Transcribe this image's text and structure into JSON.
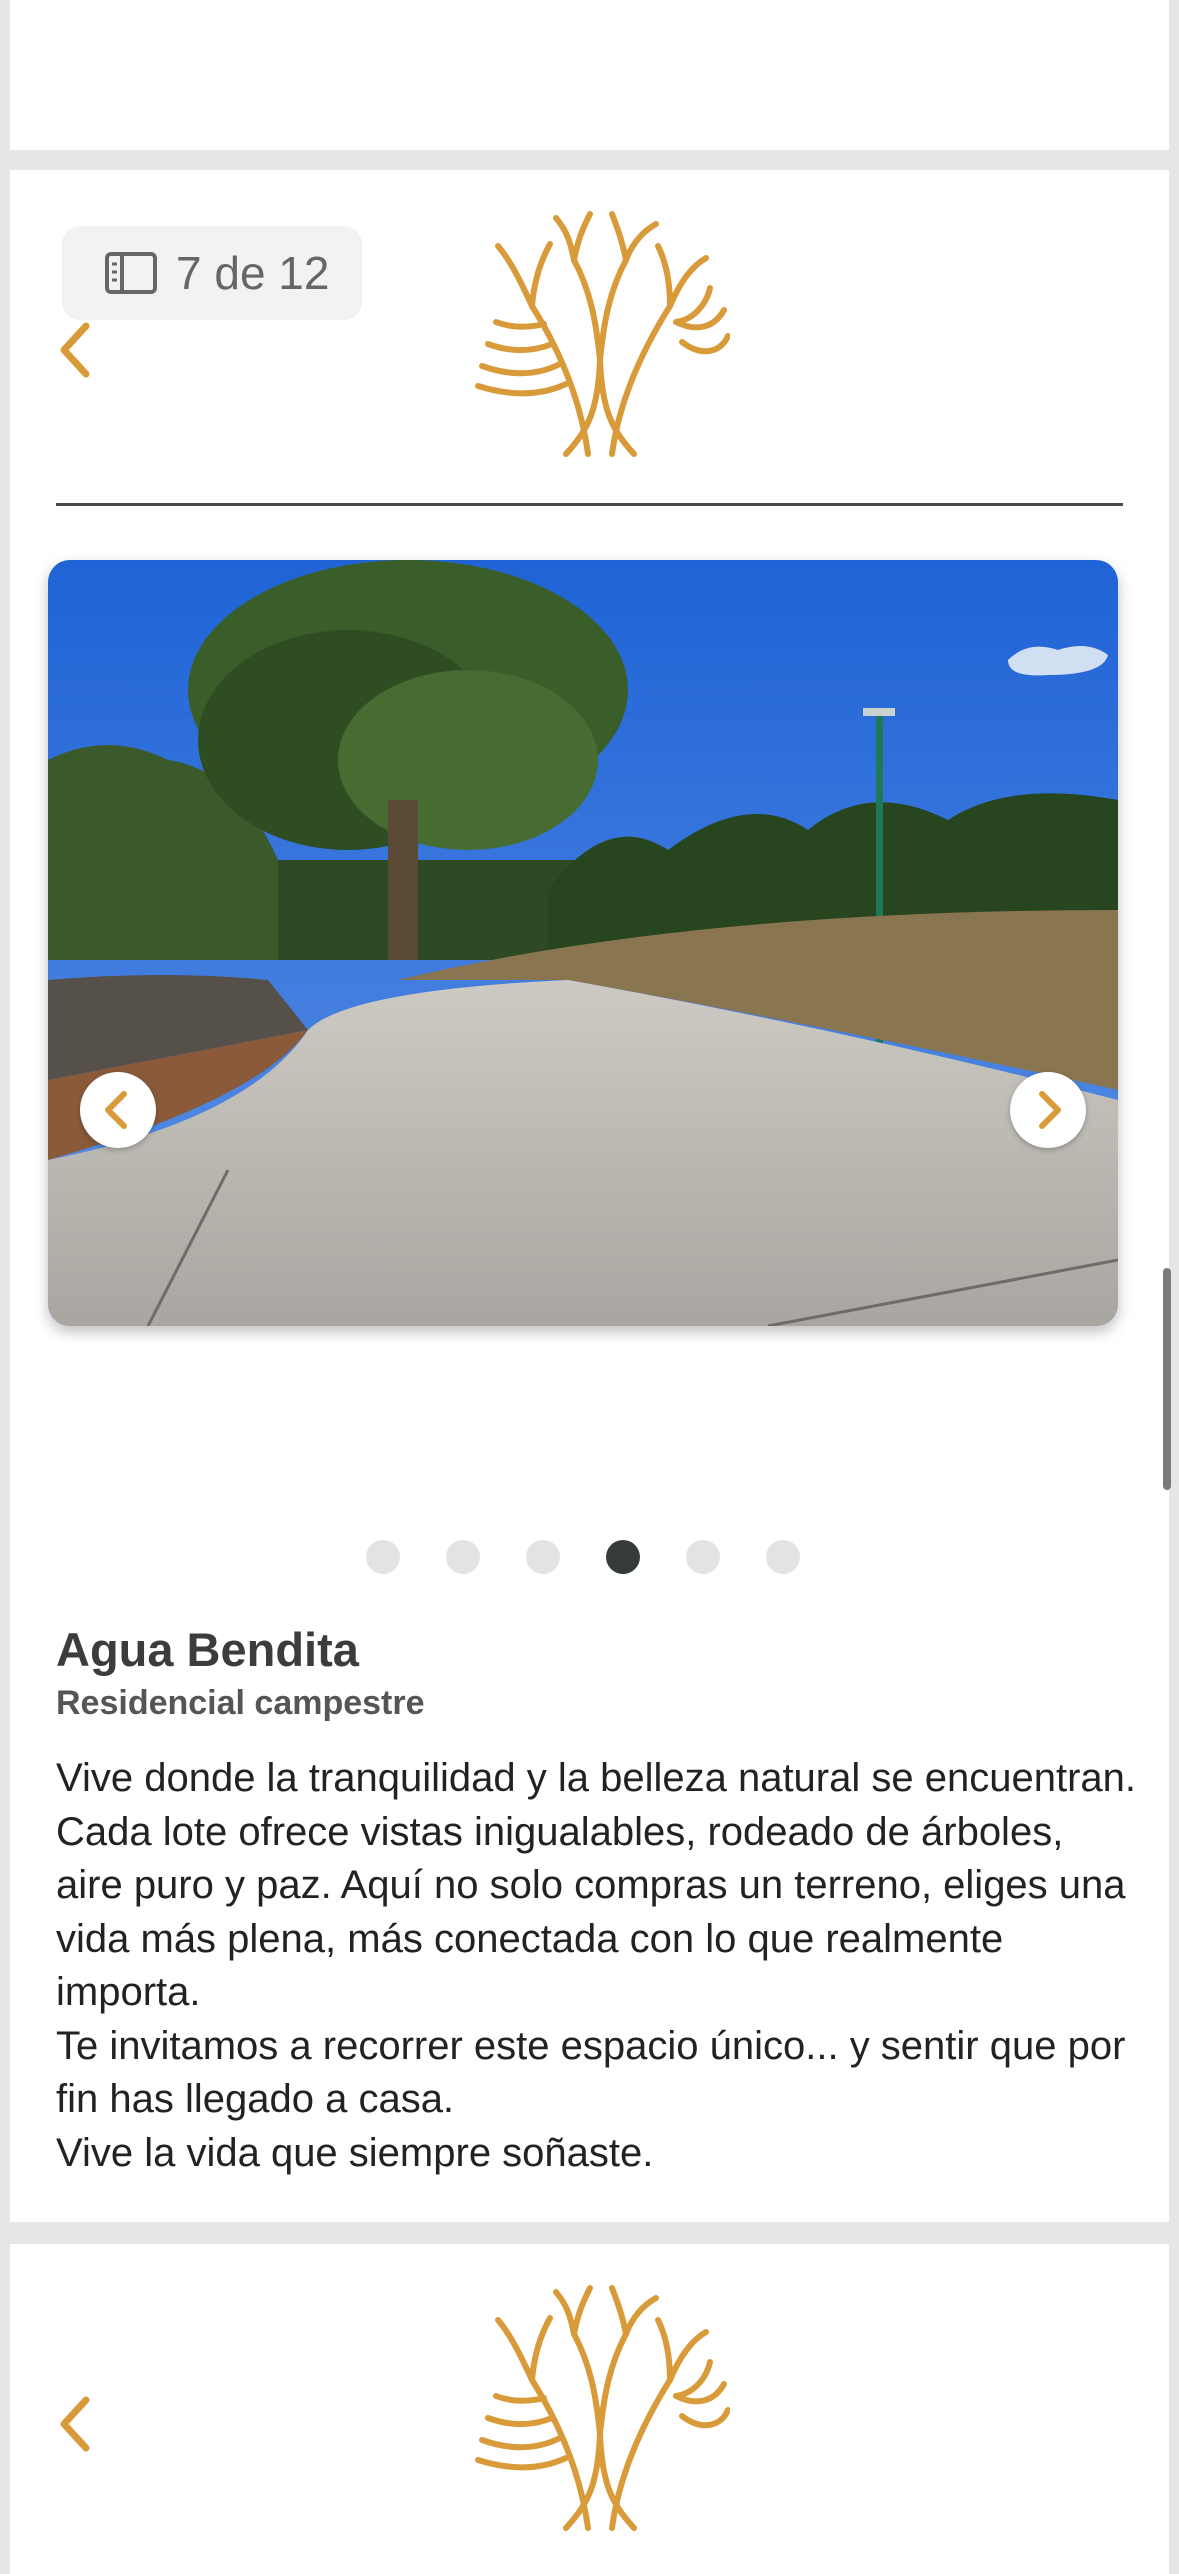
{
  "current_slide": {
    "page_indicator": "7 de 12",
    "title": "Agua Bendita",
    "subtitle": "Residencial campestre",
    "description": "Vive donde la tranquilidad y la belleza natural se encuentran.\n Cada lote ofrece vistas inigualables, rodeado de árboles, aire puro y paz. Aquí no solo compras un terreno, eliges una vida más plena, más conectada con lo que realmente importa.\n Te invitamos a recorrer este espacio único... y sentir que por fin has llegado a casa.\nVive la vida que siempre soñaste.",
    "carousel": {
      "total_dots": 6,
      "active_dot": 4
    }
  },
  "colors": {
    "brand_gold": "#d99a3a",
    "active_dot": "#343b3a",
    "inactive_dot": "#e3e3e3"
  },
  "icons": [
    "list-icon",
    "chevron-left-icon",
    "tree-logo-icon",
    "chevron-right-icon"
  ]
}
